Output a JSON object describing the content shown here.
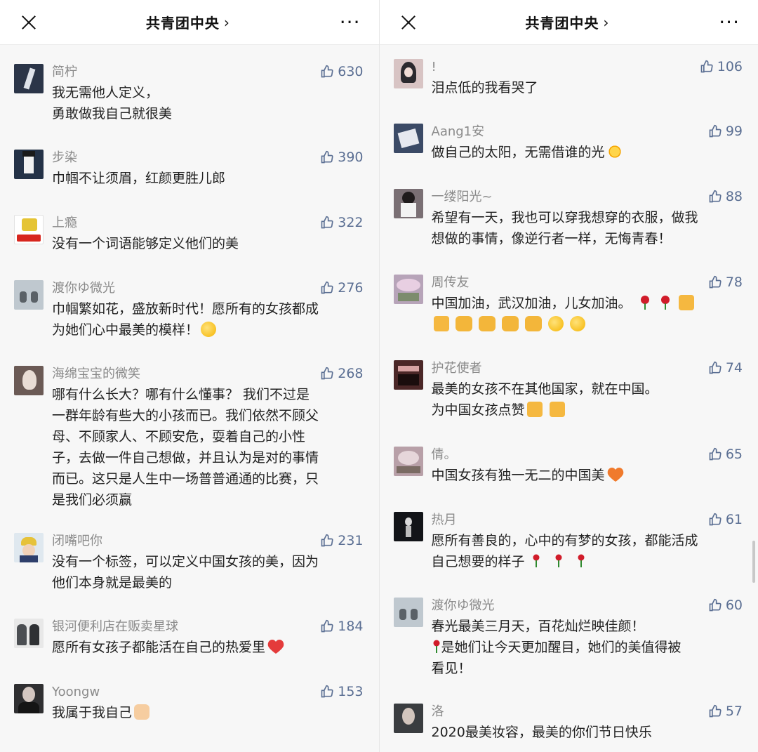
{
  "panels": [
    {
      "header": {
        "title": "共青团中央 ",
        "chevron": "›",
        "more": "···"
      },
      "comments": [
        {
          "name": "简柠",
          "likes": "630",
          "lines": [
            "我无需他人定义，",
            "勇敢做我自己就很美"
          ],
          "avatar": "#2b3548"
        },
        {
          "name": "步染",
          "likes": "390",
          "lines": [
            "巾帼不让须眉，红颜更胜儿郎"
          ],
          "avatar": "#243247"
        },
        {
          "name": "上瘾",
          "likes": "322",
          "lines": [
            "没有一个词语能够定义他们的美"
          ],
          "avatar": "#e5c434"
        },
        {
          "name": "渡你ゆ微光",
          "likes": "276",
          "lines": [
            "巾帼繁如花，盛放新时代！愿所有的女孩都成",
            "为她们心中最美的模样！"
          ],
          "avatar": "#bfc8cf"
        },
        {
          "name": "海绵宝宝的微笑",
          "likes": "268",
          "lines": [
            "哪有什么长大？哪有什么懂事？ 我们不过是",
            "一群年龄有些大的小孩而已。我们依然不顾父",
            "母、不顾家人、不顾安危，耍着自己的小性",
            "子，去做一件自己想做，并且认为是对的事情",
            "而已。这只是人生中一场普普通通的比赛，只",
            "是我们必须赢"
          ],
          "avatar": "#6b5a55"
        },
        {
          "name": "闭嘴吧你",
          "likes": "231",
          "lines": [
            "没有一个标签，可以定义中国女孩的美，因为",
            "他们本身就是最美的"
          ],
          "avatar": "#c9a85d"
        },
        {
          "name": "银河便利店在贩卖星球",
          "likes": "184",
          "lines": [
            "愿所有女孩子都能活在自己的热爱里"
          ],
          "avatar": "#8b8d90"
        },
        {
          "name": "Yoongw",
          "likes": "153",
          "lines": [
            "我属于我自己"
          ],
          "avatar": "#2f2f31"
        }
      ]
    },
    {
      "header": {
        "title": "共青团中央 ",
        "chevron": "›",
        "more": "···"
      },
      "comments": [
        {
          "name": "!",
          "likes": "106",
          "lines": [
            "泪点低的我看哭了"
          ],
          "avatar": "#d8c4c4"
        },
        {
          "name": "Aang1安",
          "likes": "99",
          "lines": [
            "做自己的太阳，无需借谁的光"
          ],
          "avatar": "#3b4a66"
        },
        {
          "name": "一缕阳光~",
          "likes": "88",
          "lines": [
            "希望有一天，我也可以穿我想穿的衣服，做我",
            "想做的事情，像逆行者一样，无悔青春！"
          ],
          "avatar": "#7a6f74"
        },
        {
          "name": "周传友",
          "likes": "78",
          "lines": [
            "中国加油，武汉加油，儿女加油。",
            ""
          ],
          "avatar": "#b7a4b9"
        },
        {
          "name": "护花使者",
          "likes": "74",
          "lines": [
            "最美的女孩不在其他国家，就在中国。",
            "为中国女孩点赞"
          ],
          "avatar": "#4b2727"
        },
        {
          "name": "倩。",
          "likes": "65",
          "lines": [
            "中国女孩有独一无二的中国美"
          ],
          "avatar": "#b8a0a8"
        },
        {
          "name": "热月",
          "likes": "61",
          "lines": [
            "愿所有善良的，心中的有梦的女孩，都能活成",
            "自己想要的样子"
          ],
          "avatar": "#121418"
        },
        {
          "name": "渡你ゆ微光",
          "likes": "60",
          "lines": [
            "春光最美三月天，百花灿烂映佳颜！",
            "是她们让今天更加醒目，她们的美值得被",
            "看见！"
          ],
          "avatar": "#bfc8cf"
        },
        {
          "name": "洛",
          "likes": "57",
          "lines": [
            "2020最美妆容，最美的你们节日快乐"
          ],
          "avatar": "#3a3d40"
        }
      ]
    }
  ]
}
